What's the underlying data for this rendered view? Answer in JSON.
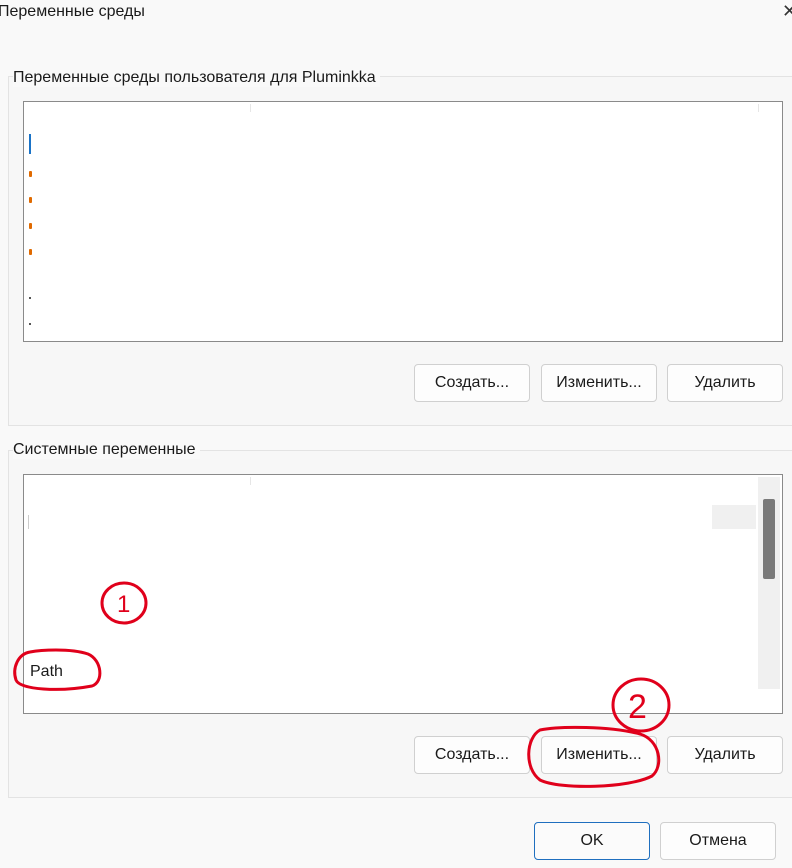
{
  "window": {
    "title": "Переменные среды",
    "close_glyph": "✕"
  },
  "user_vars": {
    "label": "Переменные среды пользователя для Pluminkka",
    "buttons": {
      "new": "Создать...",
      "edit": "Изменить...",
      "delete": "Удалить"
    }
  },
  "system_vars": {
    "label": "Системные переменные",
    "selected_variable": "Path",
    "buttons": {
      "new": "Создать...",
      "edit": "Изменить...",
      "delete": "Удалить"
    }
  },
  "footer": {
    "ok": "OK",
    "cancel": "Отмена"
  },
  "annotations": {
    "marker_1": "1",
    "marker_2": "2",
    "color": "#e0001b"
  },
  "colors": {
    "accent": "#1f6fbf",
    "marker": "#e06a00"
  }
}
